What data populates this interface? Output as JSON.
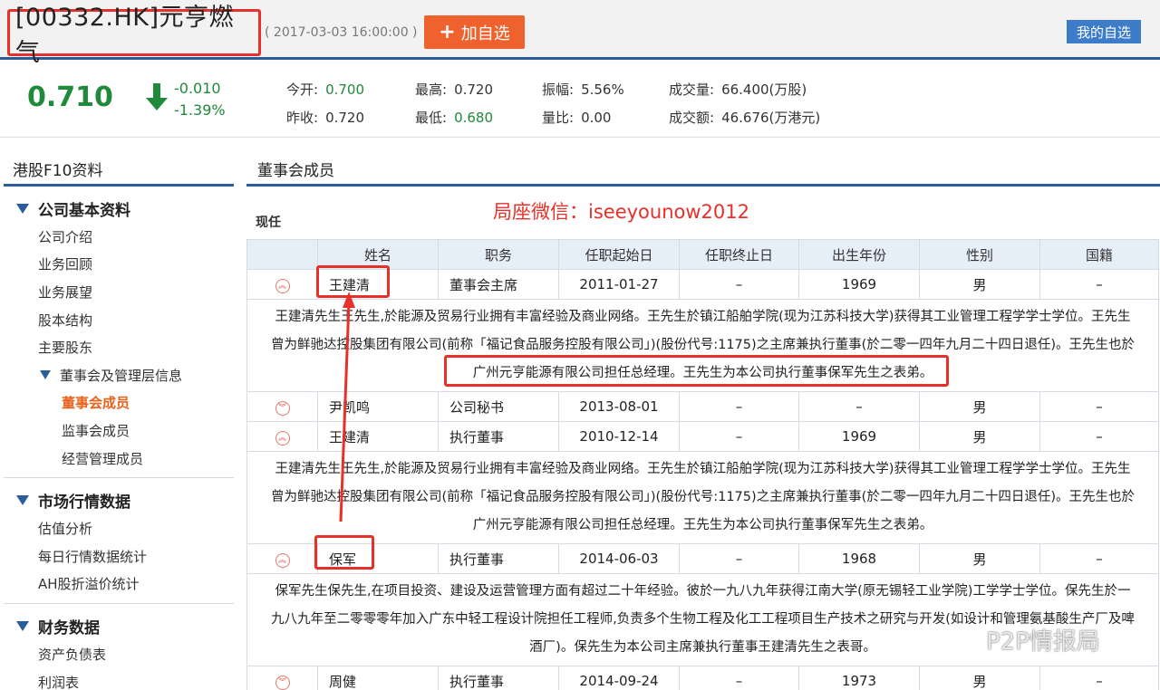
{
  "header": {
    "stock_title": "[00332.HK]元亨燃气",
    "timestamp": "( 2017-03-03 16:00:00 )",
    "add_watch_label": "加自选",
    "my_watch_label": "我的自选"
  },
  "quote": {
    "price": "0.710",
    "change": "-0.010",
    "change_pct": "-1.39%",
    "stats": [
      {
        "label": "今开:",
        "value": "0.700",
        "color": "green"
      },
      {
        "label": "最高:",
        "value": "0.720",
        "color": "normal"
      },
      {
        "label": "振幅:",
        "value": "5.56%",
        "color": "normal"
      },
      {
        "label": "成交量:",
        "value": "66.400(万股)",
        "color": "normal"
      },
      {
        "label": "昨收:",
        "value": "0.720",
        "color": "normal"
      },
      {
        "label": "最低:",
        "value": "0.680",
        "color": "green"
      },
      {
        "label": "量比:",
        "value": "0.00",
        "color": "normal"
      },
      {
        "label": "成交额:",
        "value": "46.676(万港元)",
        "color": "normal"
      }
    ]
  },
  "sidebar": {
    "title": "港股F10资料",
    "sections": [
      {
        "title": "公司基本资料",
        "items": [
          "公司介绍",
          "业务回顾",
          "业务展望",
          "股本结构",
          "主要股东"
        ],
        "group": "董事会及管理层信息",
        "sub_items": [
          "董事会成员",
          "监事会成员",
          "经营管理成员"
        ]
      },
      {
        "title": "市场行情数据",
        "items": [
          "估值分析",
          "每日行情数据统计",
          "AH股折溢价统计"
        ]
      },
      {
        "title": "财务数据",
        "items": [
          "资产负债表",
          "利润表"
        ]
      }
    ]
  },
  "main": {
    "title": "董事会成员",
    "current_label": "现任",
    "overlay_text": "局座微信：iseeyounow2012",
    "columns": [
      "",
      "姓名",
      "职务",
      "任职起始日",
      "任职终止日",
      "出生年份",
      "性别",
      "国籍"
    ],
    "rows": [
      {
        "name": "王建清",
        "position": "董事会主席",
        "start": "2011-01-27",
        "end": "–",
        "birth": "1969",
        "gender": "男",
        "nationality": "–",
        "bio": [
          "王建清先生王先生,於能源及贸易行业拥有丰富经验及商业网络。王先生於镇江船舶学院(现为江苏科技大学)获得其工业管理工程学学士学位。王先生",
          "曾为鲜驰达控股集团有限公司(前称「福记食品服务控股有限公司」)(股份代号:1175)之主席兼执行董事(於二零一四年九月二十四日退任)。王先生也於",
          "广州元亨能源有限公司担任总经理。王先生为本公司执行董事保军先生之表弟。"
        ]
      },
      {
        "name": "尹凯鸣",
        "position": "公司秘书",
        "start": "2013-08-01",
        "end": "–",
        "birth": "–",
        "gender": "男",
        "nationality": "–"
      },
      {
        "name": "王建清",
        "position": "执行董事",
        "start": "2010-12-14",
        "end": "–",
        "birth": "1969",
        "gender": "男",
        "nationality": "–",
        "bio": [
          "王建清先生王先生,於能源及贸易行业拥有丰富经验及商业网络。王先生於镇江船舶学院(现为江苏科技大学)获得其工业管理工程学学士学位。王先生",
          "曾为鲜驰达控股集团有限公司(前称「福记食品服务控股有限公司」)(股份代号:1175)之主席兼执行董事(於二零一四年九月二十四日退任)。王先生也於",
          "广州元亨能源有限公司担任总经理。王先生为本公司执行董事保军先生之表弟。"
        ]
      },
      {
        "name": "保军",
        "position": "执行董事",
        "start": "2014-06-03",
        "end": "–",
        "birth": "1968",
        "gender": "男",
        "nationality": "–",
        "bio": [
          "保军先生保先生,在项目投资、建设及运营管理方面有超过二十年经验。彼於一九八九年获得江南大学(原无锡轻工业学院)工学学士学位。保先生於一",
          "九八九年至二零零零年加入广东中轻工程设计院担任工程师,负责多个生物工程及化工工程项目生产技术之研究与开发(如设计和管理氨基酸生产厂及啤",
          "酒厂)。保先生为本公司主席兼执行董事王建清先生之表哥。"
        ]
      },
      {
        "name": "周健",
        "position": "执行董事",
        "start": "2014-09-24",
        "end": "–",
        "birth": "1973",
        "gender": "男",
        "nationality": "–"
      }
    ]
  },
  "watermark": "P2P情报局",
  "colors": {
    "accent_blue": "#2a5d9c",
    "orange": "#f0622d",
    "green": "#1f8a3a",
    "red_highlight": "#e8302a"
  }
}
